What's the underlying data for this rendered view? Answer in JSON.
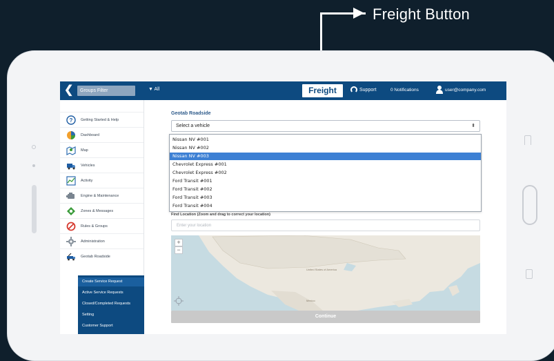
{
  "annotation": {
    "label": "Freight Button"
  },
  "topbar": {
    "groups_filter": "Groups Filter",
    "all_filter": "▼ All",
    "freight": "Freight",
    "support": "Support",
    "notifications": "0 Notifications",
    "user": "user@company.com"
  },
  "sidebar": {
    "items": [
      {
        "label": "Getting Started & Help",
        "icon": "help-circle-icon"
      },
      {
        "label": "Dashboard",
        "icon": "pie-chart-icon"
      },
      {
        "label": "Map",
        "icon": "map-icon"
      },
      {
        "label": "Vehicles",
        "icon": "truck-icon"
      },
      {
        "label": "Activity",
        "icon": "activity-chart-icon"
      },
      {
        "label": "Engine & Maintenance",
        "icon": "engine-icon"
      },
      {
        "label": "Zones & Messages",
        "icon": "zones-icon"
      },
      {
        "label": "Rules & Groups",
        "icon": "rules-icon"
      },
      {
        "label": "Administration",
        "icon": "gear-icon"
      },
      {
        "label": "Geotab Roadside",
        "icon": "tow-truck-icon"
      }
    ],
    "subitems": [
      "Create Service Request",
      "Active Service Requests",
      "Closed/Completed Requests",
      "Setting",
      "Customer Support"
    ]
  },
  "main": {
    "title": "Geotab Roadside",
    "select_value": "Select a vehicle",
    "vehicles": [
      "Nissan NV #001",
      "Nissan NV #002",
      "Nissan NV #003",
      "Chevrolet Express #001",
      "Chevrolet Express #002",
      "Ford Transit #001",
      "Ford Transit #002",
      "Ford Transit #003",
      "Ford Transit #004"
    ],
    "selected_vehicle": "Nissan NV #003",
    "location_label": "Find Location (Zoom and drag to correct your location)",
    "location_placeholder": "Enter your location",
    "map_label": "United States of America",
    "map_label_2": "Mexico",
    "zoom_in": "+",
    "zoom_out": "−",
    "continue": "Continue"
  },
  "colors": {
    "background": "#0f1f2c",
    "header": "#0d4a80",
    "selected": "#3d80d4",
    "map_water": "#c6dbe2",
    "map_land": "#ece8df"
  }
}
